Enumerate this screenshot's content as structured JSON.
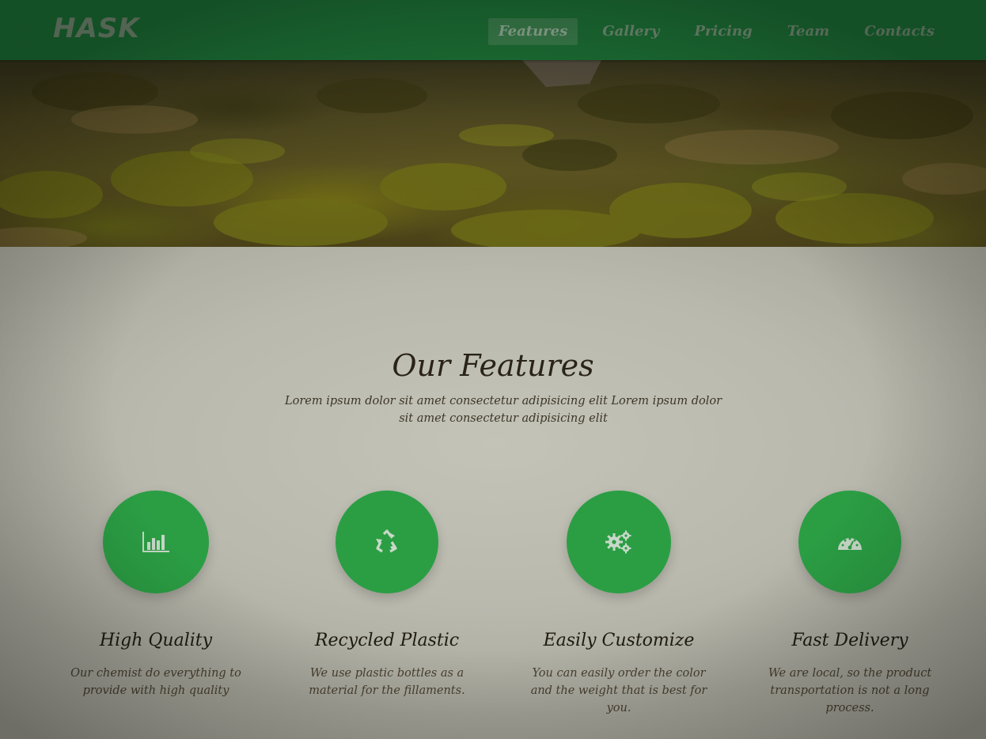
{
  "nav": {
    "brand": "HASK",
    "links": [
      {
        "label": "Features",
        "active": true
      },
      {
        "label": "Gallery",
        "active": false
      },
      {
        "label": "Pricing",
        "active": false
      },
      {
        "label": "Team",
        "active": false
      },
      {
        "label": "Contacts",
        "active": false
      }
    ]
  },
  "features_section": {
    "title": "Our Features",
    "subtitle": "Lorem ipsum dolor sit amet consectetur adipisicing elit Lorem ipsum dolor sit amet consectetur adipisicing elit",
    "items": [
      {
        "icon": "bar-chart-icon",
        "title": "High Quality",
        "description": "Our chemist do everything to provide with high quality"
      },
      {
        "icon": "recycle-icon",
        "title": "Recycled Plastic",
        "description": "We use plastic bottles as a material for the fillaments."
      },
      {
        "icon": "gears-icon",
        "title": "Easily Customize",
        "description": "You can easily order the color and the weight that is best for you."
      },
      {
        "icon": "speedometer-icon",
        "title": "Fast Delivery",
        "description": "We are local, so the product transportation is not a long process."
      }
    ]
  },
  "colors": {
    "navbar": "#1f7a3a",
    "accent_green": "#2b9e44",
    "background": "#b9b9ae"
  }
}
